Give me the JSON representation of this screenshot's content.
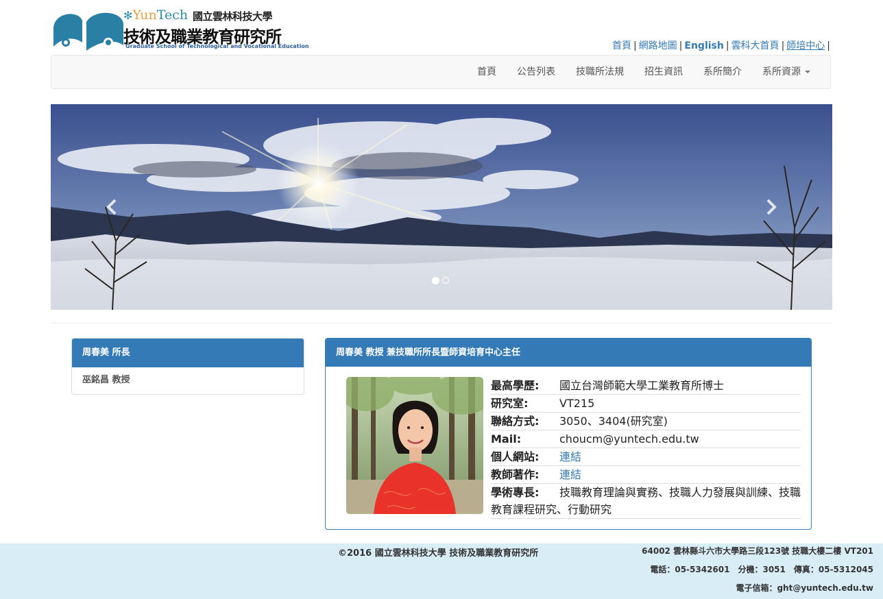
{
  "logo": {
    "yun": "Yun",
    "tech": "Tech",
    "university": "國立雲林科技大學",
    "department": "技術及職業教育研究所",
    "english_name": "Graduate School of Technological and Vocational Education"
  },
  "toplinks": [
    {
      "label": "首頁"
    },
    {
      "label": "網路地圖"
    },
    {
      "label": "English"
    },
    {
      "label": "雲科大首頁"
    },
    {
      "label": "師培中心"
    }
  ],
  "toplinks_separator": "|",
  "nav": [
    {
      "label": "首頁"
    },
    {
      "label": "公告列表"
    },
    {
      "label": "技職所法規"
    },
    {
      "label": "招生資訊"
    },
    {
      "label": "系所簡介"
    },
    {
      "label": "系所資源"
    }
  ],
  "carousel": {
    "slide_count": 2,
    "active_index": 0
  },
  "left_panel": {
    "heading": "周春美 所長",
    "items": [
      {
        "label": "巫銘昌 教授"
      }
    ]
  },
  "profile": {
    "heading": "周春美 教授 兼技職所所長暨師資培育中心主任",
    "rows": [
      {
        "label": "最高學歷:",
        "value": "國立台灣師範大學工業教育所博士"
      },
      {
        "label": "研究室:",
        "value": "VT215"
      },
      {
        "label": "聯絡方式:",
        "value": "3050、3404(研究室)"
      },
      {
        "label": "Mail:",
        "value": " choucm@yuntech.edu.tw"
      },
      {
        "label": "個人網站:",
        "link": "連結"
      },
      {
        "label": "教師著作:",
        "link": "連結"
      },
      {
        "label": "學術專長:",
        "value": "技職教育理論與實務、技職人力發展與訓練、技職教育課程研究、行動研究"
      }
    ]
  },
  "footer": {
    "copyright": "©2016 國立雲林科技大學 技術及職業教育研究所",
    "address": "64002 雲林縣斗六市大學路三段123號 技職大樓二樓 VT201",
    "phone": "電話：05-5342601　分機：3051　傳真：05-5312045",
    "email": "電子信箱：ght@yuntech.edu.tw"
  },
  "colors": {
    "primary": "#337ab7",
    "footer_bg": "#d9edf7",
    "navbar_bg": "#f8f8f8"
  }
}
